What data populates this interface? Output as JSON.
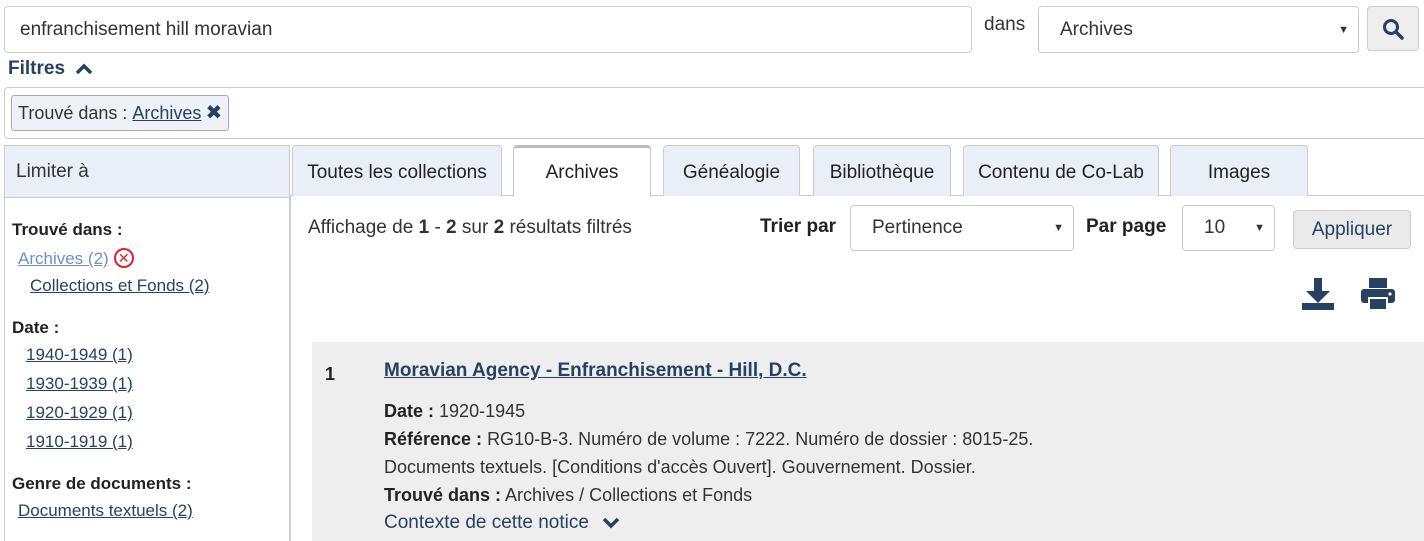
{
  "search": {
    "query": "enfranchisement hill moravian",
    "scope_label": "dans",
    "scope_value": "Archives"
  },
  "filters": {
    "toggle_label": "Filtres",
    "chip_prefix": "Trouvé dans :",
    "chip_value": "Archives"
  },
  "sidebar": {
    "heading": "Limiter à",
    "groups": [
      {
        "title": "Trouvé dans :",
        "items": [
          {
            "label": "Archives (2)"
          },
          {
            "label": "Collections et Fonds (2)"
          }
        ]
      },
      {
        "title": "Date :",
        "items": [
          {
            "label": "1940-1949 (1)"
          },
          {
            "label": "1930-1939 (1)"
          },
          {
            "label": "1920-1929 (1)"
          },
          {
            "label": "1910-1919 (1)"
          }
        ]
      },
      {
        "title": "Genre de documents :",
        "items": [
          {
            "label": "Documents textuels (2)"
          }
        ]
      }
    ]
  },
  "tabs": [
    {
      "label": "Toutes les collections",
      "active": false
    },
    {
      "label": "Archives",
      "active": true
    },
    {
      "label": "Généalogie",
      "active": false
    },
    {
      "label": "Bibliothèque",
      "active": false
    },
    {
      "label": "Contenu de Co-Lab",
      "active": false
    },
    {
      "label": "Images",
      "active": false
    }
  ],
  "results_toolbar": {
    "summary_prefix": "Affichage de",
    "range_start": "1",
    "range_sep": "-",
    "range_end": "2",
    "summary_mid": "sur",
    "total": "2",
    "summary_suffix": "résultats filtrés",
    "sort_label": "Trier par",
    "sort_value": "Pertinence",
    "per_page_label": "Par page",
    "per_page_value": "10",
    "apply_label": "Appliquer"
  },
  "results": [
    {
      "number": "1",
      "title": "Moravian Agency - Enfranchisement - Hill, D.C.",
      "date_label": "Date :",
      "date_value": "1920-1945",
      "ref_label": "Référence :",
      "ref_value": "RG10-B-3. Numéro de volume : 7222. Numéro de dossier : 8015-25.",
      "description": "Documents textuels. [Conditions d'accès Ouvert]. Gouvernement. Dossier.",
      "found_label": "Trouvé dans :",
      "found_value": "Archives / Collections et Fonds",
      "context_link": "Contexte de cette notice"
    }
  ],
  "icons": {
    "search": "magnifier-icon",
    "filters_toggle": "chevron-up-icon",
    "chip_remove": "close-x-icon",
    "facet_remove": "circle-x-icon",
    "download": "download-icon",
    "print": "printer-icon",
    "context_expand": "chevron-down-icon",
    "select_caret": "caret-down-icon"
  },
  "colors": {
    "link": "#284162",
    "tab_bg": "#eaeff7",
    "result_bg": "#eeeeee",
    "remove_red": "#d9232e"
  }
}
